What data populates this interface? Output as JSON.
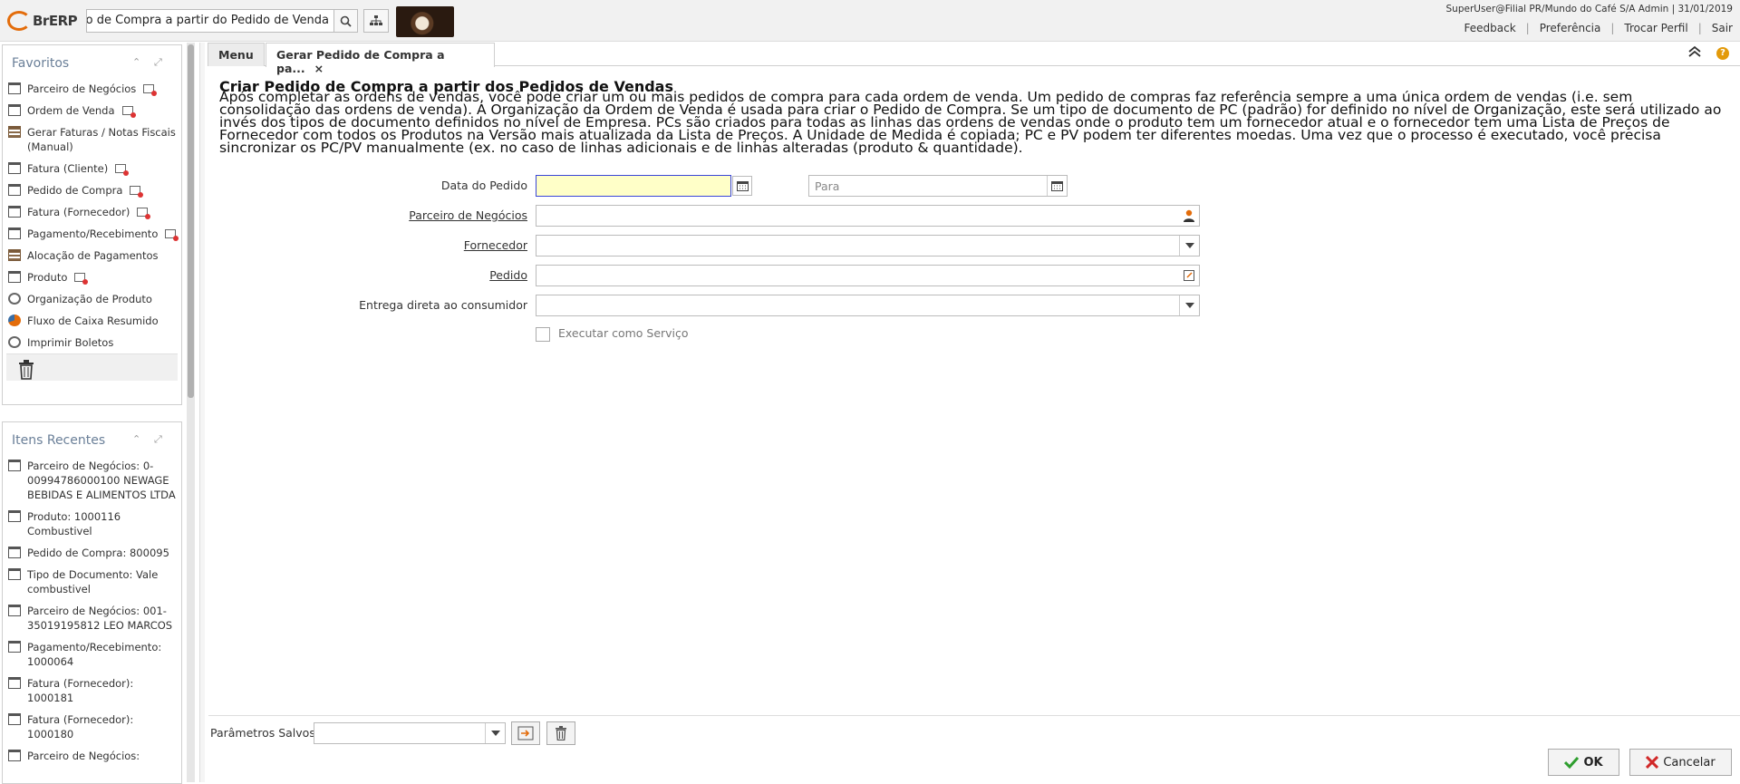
{
  "header": {
    "logo_text": "BrERP",
    "search_value": "Gerar Pedido de Compra a partir do Pedido de Venda",
    "user_info": "SuperUser@Filial PR/Mundo do Café S/A Admin | 31/01/2019",
    "links": [
      "Feedback",
      "Preferência",
      "Trocar Perfil",
      "Sair"
    ]
  },
  "favorites": {
    "title": "Favoritos",
    "items": [
      {
        "label": "Parceiro de Negócios",
        "icon": "window-icon",
        "new": true
      },
      {
        "label": "Ordem de Venda",
        "icon": "window-icon",
        "new": true
      },
      {
        "label": "Gerar Faturas / Notas Fiscais (Manual)",
        "icon": "form-icon",
        "new": false
      },
      {
        "label": "Fatura (Cliente)",
        "icon": "window-icon",
        "new": true
      },
      {
        "label": "Pedido de Compra",
        "icon": "window-icon",
        "new": true
      },
      {
        "label": "Fatura (Fornecedor)",
        "icon": "window-icon",
        "new": true
      },
      {
        "label": "Pagamento/Recebimento",
        "icon": "window-icon",
        "new": true
      },
      {
        "label": "Alocação de Pagamentos",
        "icon": "form-icon",
        "new": false
      },
      {
        "label": "Produto",
        "icon": "window-icon",
        "new": true
      },
      {
        "label": "Organização de Produto",
        "icon": "process-icon",
        "new": false
      },
      {
        "label": "Fluxo de Caixa Resumido",
        "icon": "report-icon",
        "new": false
      },
      {
        "label": "Imprimir Boletos",
        "icon": "process-icon",
        "new": false
      }
    ]
  },
  "recent": {
    "title": "Itens Recentes",
    "items": [
      "Parceiro de Negócios: 0-00994786000100 NEWAGE BEBIDAS E ALIMENTOS LTDA",
      "Produto: 1000116 Combustivel",
      "Pedido de Compra: 800095",
      "Tipo de Documento: Vale combustivel",
      "Parceiro de Negócios: 001-35019195812 LEO MARCOS",
      "Pagamento/Recebimento: 1000064",
      "Fatura (Fornecedor): 1000181",
      "Fatura (Fornecedor): 1000180",
      "Parceiro de Negócios:"
    ]
  },
  "tabs": {
    "menu": "Menu",
    "active": "Gerar Pedido de Compra a pa...",
    "close": "×"
  },
  "process": {
    "title": "Criar Pedido de Compra a partir dos Pedidos de Vendas",
    "description": "Após completar as ordens de vendas, você pode criar um ou mais pedidos de compra para cada ordem de venda. Um pedido de compras faz referência sempre a uma única ordem de vendas (i.e. sem consolidação das ordens de venda). A Organização da Ordem de Venda é usada para criar o Pedido de Compra. Se um tipo de documento de PC (padrão) for definido no nível de Organização, este será utilizado ao invés dos tipos de documento definidos no nível de Empresa. PCs são criados para todas as linhas das ordens de vendas onde o produto tem um fornecedor atual e o fornecedor tem uma Lista de Preços de Fornecedor com todos os Produtos na Versão mais atualizada da Lista de Preços. A Unidade de Medida é copiada; PC e PV podem ter diferentes moedas. Uma vez que o processo é executado, você precisa sincronizar os PC/PV manualmente (ex. no caso de linhas adicionais e de linhas alteradas (produto & quantidade)."
  },
  "form": {
    "date_label": "Data do Pedido",
    "date_from": "",
    "date_to_placeholder": "Para",
    "bpartner_label": "Parceiro de Negócios",
    "vendor_label": "Fornecedor",
    "order_label": "Pedido",
    "dropship_label": "Entrega direta ao consumidor",
    "run_as_service_label": "Executar como Serviço"
  },
  "footer": {
    "saved_params_label": "Parâmetros Salvos",
    "ok_label": "OK",
    "cancel_label": "Cancelar"
  },
  "colors": {
    "accent": "#e36c0a",
    "focus_field_bg": "#ffffc8",
    "ok_green": "#2e9e2e",
    "cancel_red": "#d12828"
  }
}
